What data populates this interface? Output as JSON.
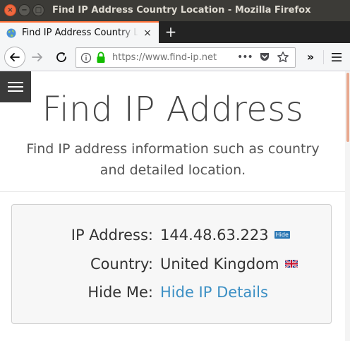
{
  "window": {
    "title": "Find IP Address Country Location - Mozilla Firefox",
    "close_glyph": "×",
    "minimize_glyph": "−",
    "maximize_glyph": "□"
  },
  "tab": {
    "label": "Find IP Address Country Location",
    "close_glyph": "×",
    "new_tab_glyph": "+",
    "accent_color": "#ff7139"
  },
  "navbar": {
    "url": "https://www.find-ip.net",
    "more_glyph": "•••",
    "overflow_glyph": "»",
    "icons": [
      "back-arrow-icon",
      "forward-arrow-icon",
      "reload-icon",
      "info-icon",
      "lock-icon",
      "pocket-icon",
      "star-icon",
      "hamburger-menu-icon"
    ]
  },
  "page": {
    "title": "Find IP Address",
    "subtitle": "Find IP address information such as country and detailed location.",
    "rows": [
      {
        "label": "IP Address:",
        "value": "144.48.63.223",
        "badge": "Hide"
      },
      {
        "label": "Country:",
        "value": "United Kingdom",
        "flag": "uk-flag-icon"
      },
      {
        "label": "Hide Me:",
        "value": "Hide IP Details"
      }
    ],
    "link_color": "#3b8fc4",
    "scroll_thumb_color": "#e8a88e"
  }
}
